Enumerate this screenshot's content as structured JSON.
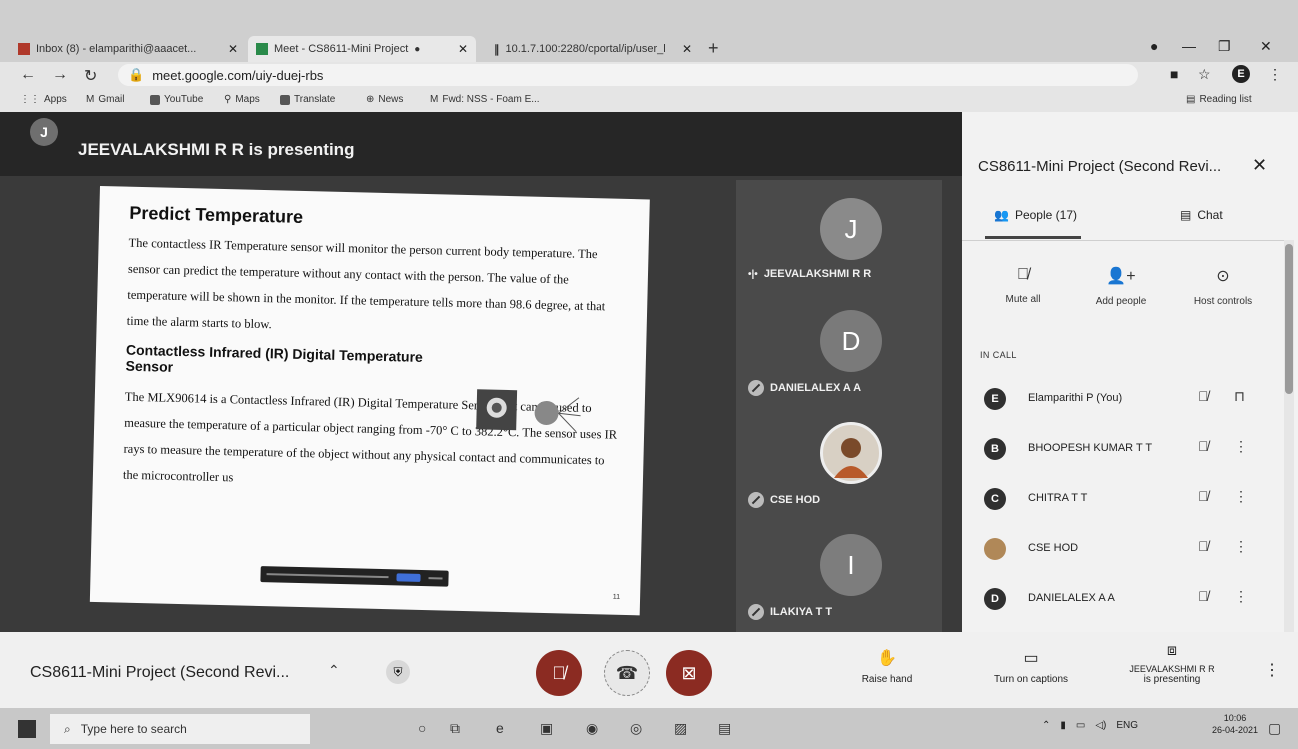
{
  "browser": {
    "tabs": [
      {
        "title": "Inbox (8) - elamparithi@aaacet..."
      },
      {
        "title": "Meet - CS8611-Mini Project"
      },
      {
        "title": "10.1.7.100:2280/cportal/ip/user_l"
      }
    ],
    "url": "meet.google.com/uiy-duej-rbs",
    "bookmarks": [
      "Apps",
      "Gmail",
      "YouTube",
      "Maps",
      "Translate",
      "News",
      "Fwd: NSS - Foam E..."
    ],
    "reading_list": "Reading list",
    "profile_initial": "E"
  },
  "meet": {
    "presenter_initial": "J",
    "presenter_banner": "JEEVALAKSHMI R R is presenting",
    "slide": {
      "title": "Predict Temperature",
      "paragraph1": "The contactless IR Temperature sensor will monitor the person current body temperature. The sensor can predict the temperature without any contact with the person. The value of the temperature will be shown in the monitor. If the temperature tells more than 98.6 degree, at that time the alarm starts to blow.",
      "subtitle": "Contactless Infrared (IR) Digital Temperature Sensor",
      "paragraph2": "The MLX90614 is a Contactless Infrared (IR) Digital Temperature Sensor that can be used to measure the temperature of a particular object ranging from -70° C to 382.2°C. The sensor uses IR rays to measure the temperature of the object without any physical contact and communicates to the microcontroller us",
      "page_number": "11"
    },
    "tiles": [
      {
        "initial": "J",
        "name": "JEEVALAKSHMI R R",
        "color": "#8a8a8a"
      },
      {
        "initial": "D",
        "name": "DANIELALEX A A",
        "color": "#7a7a7a"
      },
      {
        "initial": "",
        "name": "CSE HOD",
        "color": "#a89070"
      },
      {
        "initial": "I",
        "name": "ILAKIYA T T",
        "color": "#7d7d7d"
      }
    ]
  },
  "panel": {
    "title": "CS8611-Mini Project (Second Revi...",
    "tab_people": "People (17)",
    "tab_chat": "Chat",
    "actions": [
      "Mute all",
      "Add people",
      "Host controls"
    ],
    "in_call_label": "IN CALL",
    "people": [
      {
        "initial": "E",
        "name": "Elamparithi P (You)"
      },
      {
        "initial": "B",
        "name": "BHOOPESH KUMAR T T"
      },
      {
        "initial": "C",
        "name": "CHITRA T T"
      },
      {
        "initial": "",
        "name": "CSE HOD"
      },
      {
        "initial": "D",
        "name": "DANIELALEX A A"
      }
    ]
  },
  "bottombar": {
    "meeting_name": "CS8611-Mini Project (Second Revi...",
    "raise_hand": "Raise hand",
    "captions": "Turn on captions",
    "presenting_line1": "JEEVALAKSHMI R R",
    "presenting_line2": "is presenting",
    "mic_color": "#c0392b",
    "cam_color": "#c0392b"
  },
  "taskbar": {
    "search_placeholder": "Type here to search",
    "language": "ENG",
    "time": "10:06",
    "date": "26-04-2021"
  }
}
